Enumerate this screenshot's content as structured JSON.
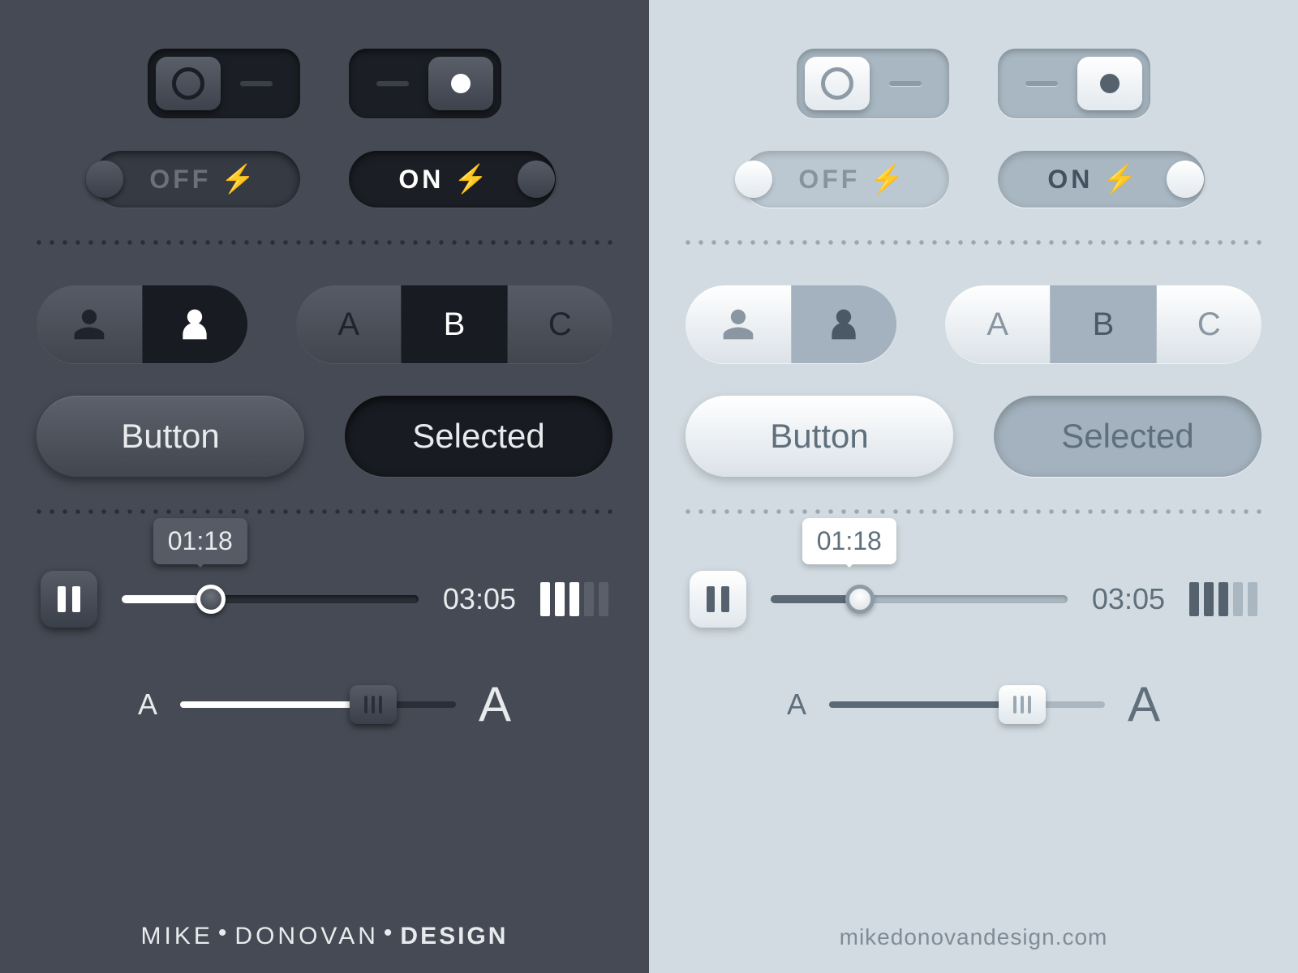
{
  "themes": [
    "dark",
    "light"
  ],
  "toggles": {
    "off_label": "OFF",
    "on_label": "ON"
  },
  "segments": {
    "persons": [
      "male",
      "female"
    ],
    "abc": [
      "A",
      "B",
      "C"
    ]
  },
  "buttons": {
    "normal": "Button",
    "selected": "Selected"
  },
  "media": {
    "tooltip_time": "01:18",
    "total_time": "03:05",
    "progress_pct": 30,
    "volume_bars": 5,
    "volume_active": 3
  },
  "font_slider": {
    "min_label": "A",
    "max_label": "A",
    "position_pct": 70
  },
  "footer": {
    "dark_brand_1": "MIKE",
    "dark_brand_2": "DONOVAN",
    "dark_brand_3": "DESIGN",
    "light_url": "mikedonovandesign.com"
  },
  "colors": {
    "dark_bg": "#454a54",
    "light_bg": "#d1dbe1"
  }
}
